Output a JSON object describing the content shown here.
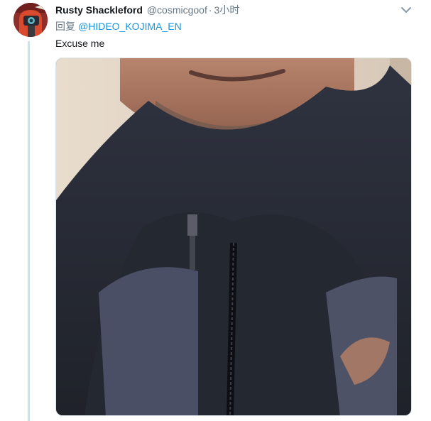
{
  "tweet": {
    "display_name": "Rusty Shackleford",
    "handle": "@cosmicgoof",
    "separator": "·",
    "timestamp": "3小时",
    "reply_prefix": "回复",
    "reply_to": "@HIDEO_KOJIMA_EN",
    "text": "Excuse me"
  },
  "icons": {
    "avatar": "avatar-image",
    "more": "chevron-down-icon"
  },
  "colors": {
    "thread_line": "#c4e4f6",
    "link": "#1b95e0",
    "secondary_text": "#657786",
    "primary_text": "#14171a"
  }
}
